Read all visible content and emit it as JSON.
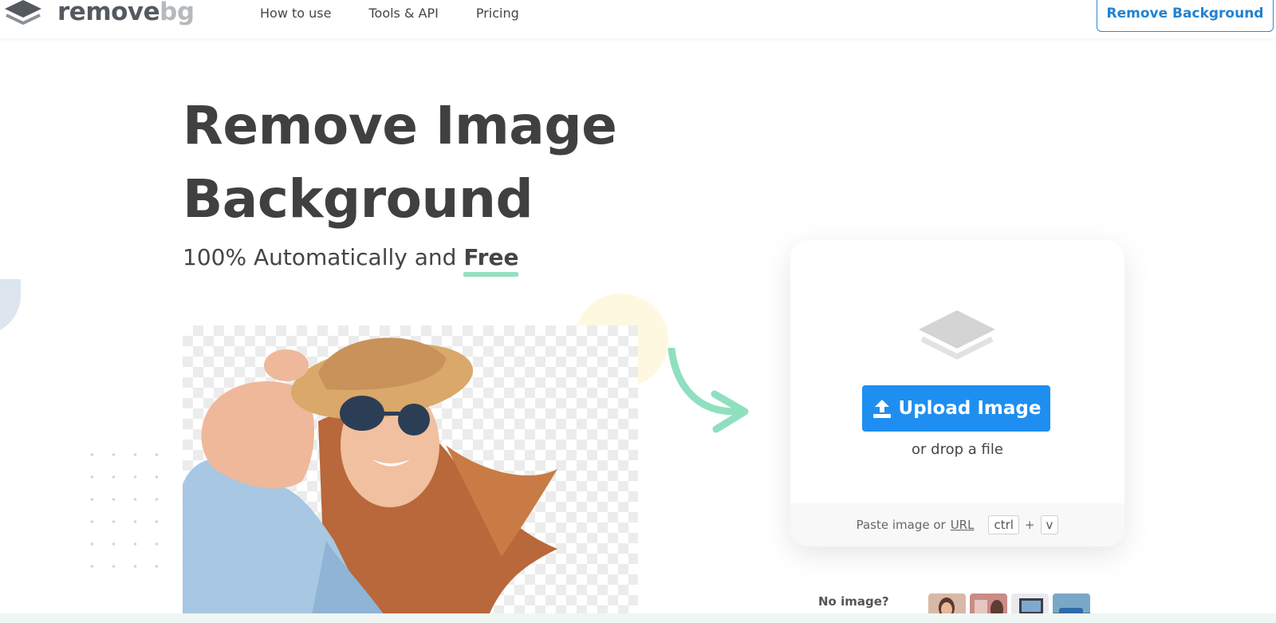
{
  "header": {
    "logo": {
      "word1": "remove",
      "word2": "bg"
    },
    "nav": [
      "How to use",
      "Tools & API",
      "Pricing"
    ],
    "cta_label": "Remove Background"
  },
  "hero": {
    "title_line1": "Remove Image",
    "title_line2": "Background",
    "subtitle_prefix": "100% Automatically and",
    "subtitle_emphasis": "Free"
  },
  "upload": {
    "button_label": "Upload Image",
    "drop_text": "or drop a file",
    "paste_prefix": "Paste image or",
    "paste_url": "URL",
    "shortcut_key1": "ctrl",
    "shortcut_plus": "+",
    "shortcut_key2": "v"
  },
  "samples": {
    "label": "No image?"
  },
  "colors": {
    "brand_blue": "#1e8ff0",
    "accent_green": "#94e0c0",
    "heading": "#404040"
  },
  "icons": [
    "logo-layers-icon",
    "upload-icon",
    "layers-icon",
    "curved-arrow-icon"
  ]
}
